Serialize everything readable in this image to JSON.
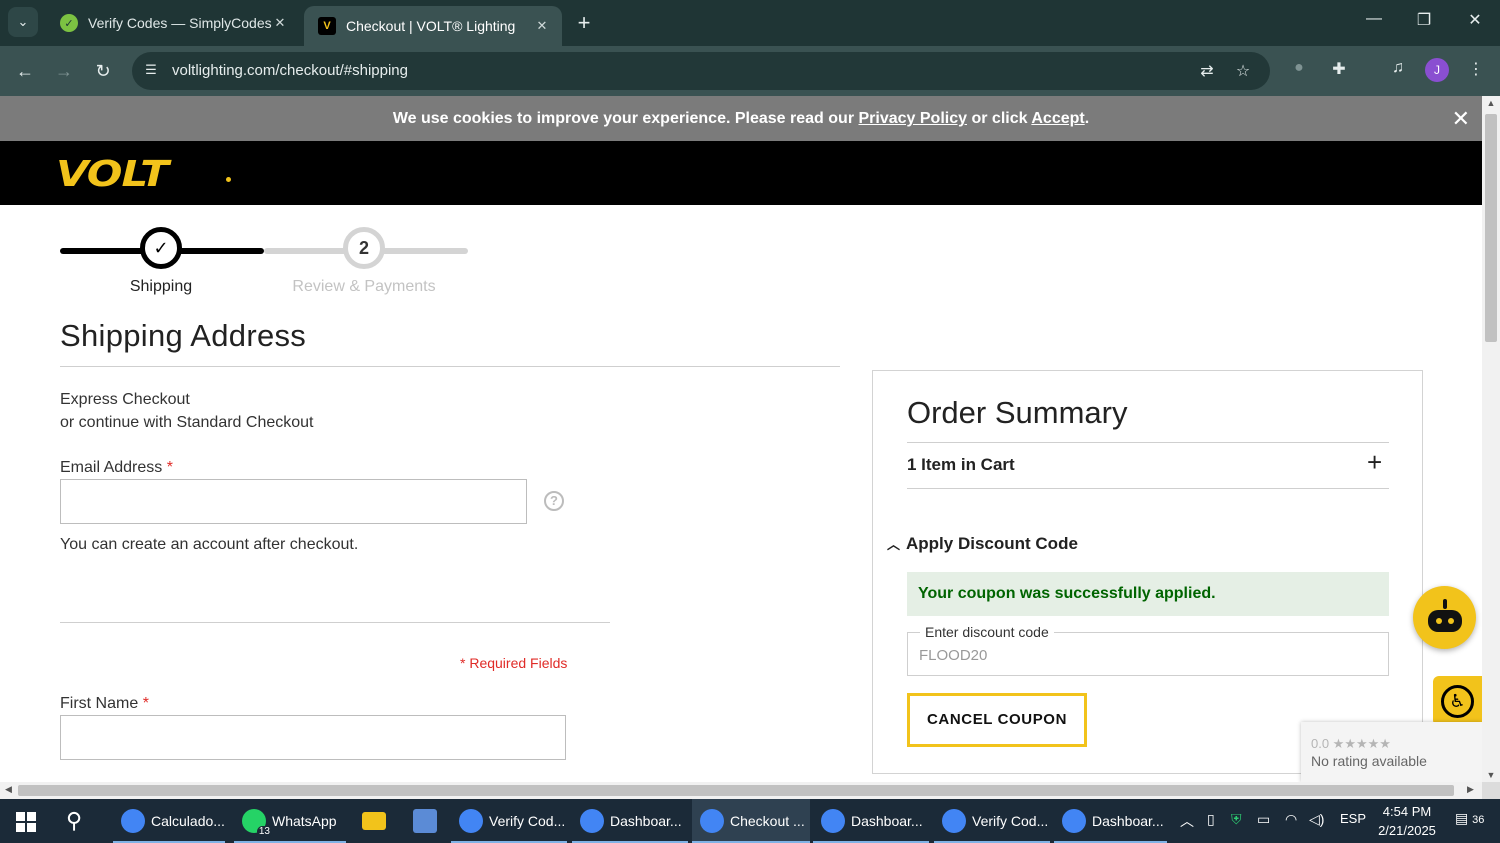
{
  "browser": {
    "tabs": [
      {
        "title": "Verify Codes — SimplyCodes",
        "active": false
      },
      {
        "title": "Checkout | VOLT® Lighting",
        "active": true
      }
    ],
    "url": "voltlighting.com/checkout/#shipping",
    "profile_initial": "J"
  },
  "cookie_banner": {
    "text_before": "We use cookies to improve your experience. Please read our",
    "privacy_link": "Privacy Policy",
    "text_middle": "or click",
    "accept_link": "Accept",
    "text_after": "."
  },
  "header": {
    "logo_text": "VOLT"
  },
  "progress": {
    "steps": [
      {
        "number": "1",
        "label": "Shipping",
        "state": "complete"
      },
      {
        "number": "2",
        "label": "Review & Payments",
        "state": "upcoming"
      }
    ]
  },
  "shipping": {
    "title": "Shipping Address",
    "express_line1": "Express Checkout",
    "express_line2": "or continue with Standard Checkout",
    "email_label": "Email Address",
    "required_mark": "*",
    "email_value": "",
    "email_note": "You can create an account after checkout.",
    "required_fields_note": "* Required Fields",
    "first_name_label": "First Name",
    "first_name_value": ""
  },
  "summary": {
    "title": "Order Summary",
    "items_label": "1 Item in Cart",
    "discount_heading": "Apply Discount Code",
    "success_message": "Your coupon was successfully applied.",
    "discount_field_label": "Enter discount code",
    "discount_value": "FLOOD20",
    "cancel_label": "CANCEL COUPON"
  },
  "recaptcha": {
    "rating": "0.0 ★★★★★",
    "status": "No rating available"
  },
  "taskbar": {
    "items": [
      {
        "label": "Calculado...",
        "color": "#4caf50"
      },
      {
        "label": "WhatsApp",
        "color": "#25d366",
        "badge": "13"
      },
      {
        "label": "",
        "color": "#f2c31b"
      },
      {
        "label": "",
        "color": "#5b8bd6"
      },
      {
        "label": "Verify Cod...",
        "color": "#4285f4"
      },
      {
        "label": "Dashboar...",
        "color": "#4285f4"
      },
      {
        "label": "Checkout ...",
        "color": "#4285f4"
      },
      {
        "label": "Dashboar...",
        "color": "#4285f4"
      },
      {
        "label": "Verify Cod...",
        "color": "#4285f4"
      },
      {
        "label": "Dashboar...",
        "color": "#4285f4"
      }
    ],
    "lang": "ESP",
    "time": "4:54 PM",
    "date": "2/21/2025",
    "notifications": "36"
  }
}
